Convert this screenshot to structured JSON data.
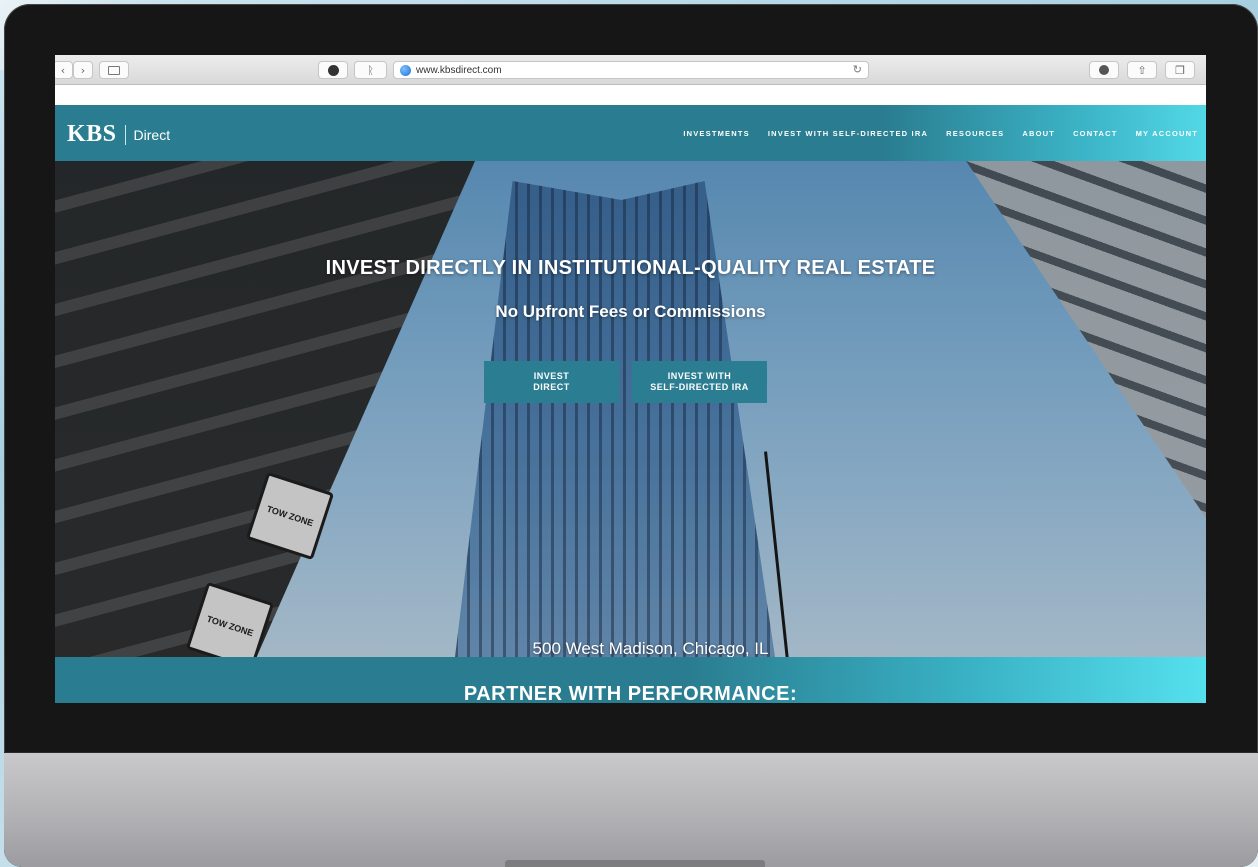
{
  "browser": {
    "url": "www.kbsdirect.com",
    "back_icon": "chevron-left-icon",
    "forward_icon": "chevron-right-icon",
    "sidebar_icon": "sidebar-icon",
    "pinterest_icon": "pinterest-icon",
    "extension_icon": "extension-icon",
    "reload_icon": "reload-icon",
    "download_icon": "download-icon",
    "share_icon": "share-icon",
    "tabs_icon": "tabs-icon"
  },
  "site": {
    "logo_main": "KBS",
    "logo_sub": "Direct",
    "nav": [
      "INVESTMENTS",
      "INVEST WITH SELF-DIRECTED IRA",
      "RESOURCES",
      "ABOUT",
      "CONTACT",
      "MY ACCOUNT"
    ],
    "hero": {
      "title": "INVEST DIRECTLY IN INSTITUTIONAL-QUALITY REAL ESTATE",
      "subtitle": "No Upfront Fees or Commissions",
      "cta_primary": "INVEST\nDIRECT",
      "cta_secondary": "INVEST WITH\nSELF-DIRECTED IRA",
      "caption": "500 West Madison, Chicago, IL",
      "signs": [
        "TOW ZONE",
        "TOW ZONE"
      ]
    },
    "band_title": "PARTNER WITH PERFORMANCE:"
  },
  "colors": {
    "brand_teal": "#2a7d90",
    "accent_cyan": "#55e0ee"
  }
}
